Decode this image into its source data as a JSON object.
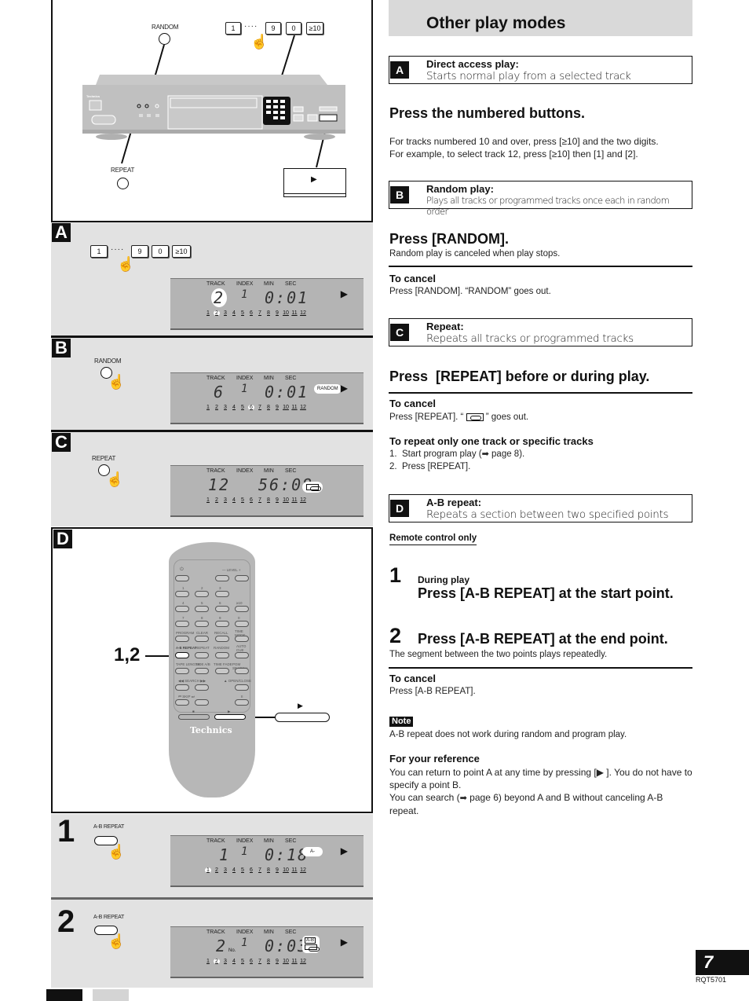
{
  "header": {
    "title": "Other play modes"
  },
  "modes": [
    {
      "letter": "A",
      "title": "Direct access play:",
      "desc": "Starts normal play from a selected track"
    },
    {
      "letter": "B",
      "title": "Random play:",
      "desc": "Plays all tracks or programmed tracks once each in random order"
    },
    {
      "letter": "C",
      "title": "Repeat:",
      "desc": "Repeats all tracks or programmed tracks"
    },
    {
      "letter": "D",
      "title": "A-B repeat:",
      "desc": "Repeats a section between two specified points"
    }
  ],
  "section_a": {
    "heading": "Press the numbered buttons.",
    "body_1": "For tracks numbered 10 and over, press [≥10] and the two digits.",
    "body_2": "For example, to select track 12, press [≥10] then [1] and [2]."
  },
  "section_b": {
    "heading": "Press [RANDOM].",
    "sub": "Random play is canceled when play stops.",
    "cancel_title": "To cancel",
    "cancel_body": "Press [RANDOM]. “RANDOM” goes out."
  },
  "section_c": {
    "heading": "Press  [REPEAT] before or during play.",
    "cancel_title": "To cancel",
    "cancel_body_pre": "Press [REPEAT]. “ ",
    "cancel_body_post": " ” goes out.",
    "specific_title": "To repeat only one track or specific tracks",
    "steps": [
      "1.  Start program play (",
      "page 8).",
      "2.  Press [REPEAT]."
    ]
  },
  "section_d": {
    "remote_only": "Remote control only",
    "step1_num": "1",
    "step1_sub": "During play",
    "step1_heading": "Press [A-B REPEAT] at the start point.",
    "step2_num": "2",
    "step2_heading": "Press [A-B REPEAT] at the end point.",
    "step2_body": "The segment between the two points plays repeatedly.",
    "cancel_title": "To cancel",
    "cancel_body": "Press [A-B REPEAT].",
    "note_tag": "Note",
    "note_body": "A-B repeat does not work during random and program play.",
    "ref_title": "For your reference",
    "ref_body_1a": "You can return to point A at any time by pressing [",
    "ref_body_1b": " ]. You do not have to specify a point B.",
    "ref_body_2a": "You can search (",
    "ref_body_2b": " page 6) beyond A and B without canceling A-B repeat."
  },
  "icons": {
    "play": "▶",
    "arrow_right": "➡",
    "hand": "☝"
  },
  "illustration": {
    "top": {
      "random_label": "RANDOM",
      "repeat_label": "REPEAT",
      "keys": [
        "1",
        "9",
        "0",
        "≥10"
      ],
      "dots": "····",
      "brand": "Technics",
      "play_symbol": "▶"
    },
    "panel_a": {
      "letter": "A",
      "keys": [
        "1",
        "9",
        "0",
        "≥10"
      ],
      "dots": "····"
    },
    "panel_b": {
      "letter": "B",
      "button_label": "RANDOM"
    },
    "panel_c": {
      "letter": "C",
      "button_label": "REPEAT"
    },
    "panel_d": {
      "letter": "D",
      "callout": "1,2",
      "play_symbol": "▶",
      "brand": "Technics"
    },
    "panel_1": {
      "num": "1",
      "button_label": "A-B REPEAT"
    },
    "panel_2": {
      "num": "2",
      "button_label": "A-B REPEAT"
    },
    "lcd_headers": [
      "TRACK",
      "INDEX",
      "MIN",
      "SEC"
    ],
    "lcd_tracks": [
      "1",
      "2",
      "3",
      "4",
      "5",
      "6",
      "7",
      "8",
      "9",
      "10",
      "11",
      "12"
    ],
    "displays": [
      {
        "panel": "A",
        "track": "2",
        "index": "1",
        "time": "0:01",
        "badge": "",
        "play": "▶",
        "highlight": "2"
      },
      {
        "panel": "B",
        "track": "6",
        "index": "1",
        "time": "0:01",
        "badge": "RANDOM",
        "play": "▶",
        "highlight": "6"
      },
      {
        "panel": "C",
        "track": "12",
        "index": "",
        "time": "56:08",
        "badge": "repeat",
        "play": "",
        "highlight": ""
      },
      {
        "panel": "1",
        "track": "1",
        "index": "1",
        "time": "0:18",
        "badge": "A-",
        "play": "▶",
        "highlight": "1"
      },
      {
        "panel": "2",
        "track": "2",
        "index": "1",
        "time": "0:03",
        "badge": "A-B",
        "play": "▶",
        "highlight": "2",
        "no_label": "No."
      }
    ],
    "remote_labels": {
      "row_numbers_1": [
        "1",
        "2",
        "3"
      ],
      "row_numbers_2": [
        "4",
        "5",
        "6",
        "≥10"
      ],
      "row_numbers_3": [
        "7",
        "8",
        "9",
        "0"
      ],
      "row_func_1": [
        "PROGRAM",
        "CLEAR",
        "RECALL",
        "TIME MODE"
      ],
      "row_func_2": [
        "A-B REPEAT",
        "REPEAT",
        "RANDOM",
        "AUTO CUE"
      ],
      "row_func_3": [
        "TAPE LENGTH",
        "SIDE A/B",
        "TIME FADE",
        "PGM SEARCH"
      ],
      "search": "◀◀ SEARCH ▶▶",
      "open_close": "▲ OPEN/CLOSE",
      "skip": "⏮ SKIP ⏭",
      "pause": "II",
      "stop": "■",
      "play": "▶",
      "level": "— LEVEL +",
      "power": "⏻"
    }
  },
  "footer": {
    "page_number": "7",
    "doc_code": "RQT5701"
  }
}
